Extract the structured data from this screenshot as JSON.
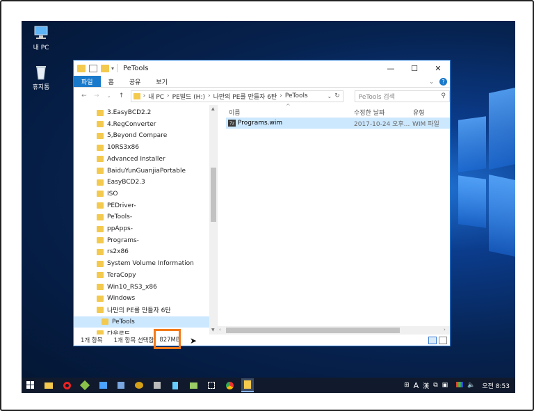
{
  "desktop": {
    "icons": [
      {
        "label": "내 PC",
        "icon": "computer-icon"
      },
      {
        "label": "휴지통",
        "icon": "recycle-bin-icon"
      }
    ]
  },
  "window": {
    "title": "PeTools",
    "controls": {
      "minimize": "—",
      "maximize": "☐",
      "close": "✕"
    },
    "ribbon_tabs": [
      "파일",
      "홈",
      "공유",
      "보기"
    ],
    "address": [
      "내 PC",
      "PE빌드 (H:)",
      "나만의 PE를 만들자 6탄",
      "PeTools"
    ],
    "search_placeholder": "PeTools 검색",
    "nav_items": [
      "3.EasyBCD2.2",
      "4.RegConverter",
      "5,Beyond Compare",
      "10RS3x86",
      "Advanced Installer",
      "BaiduYunGuanjiaPortable",
      "EasyBCD2.3",
      "ISO",
      "PEDriver-",
      "PeTools-",
      "ppApps-",
      "Programs-",
      "rs2x86",
      "System Volume Information",
      "TeraCopy",
      "Win10_RS3_x86",
      "Windows",
      "나만의 PE를 만들자 6탄",
      "PeTools",
      "다운로드"
    ],
    "selected_nav": "PeTools",
    "columns": {
      "name": "이름",
      "date": "수정한 날짜",
      "type": "유형"
    },
    "file": {
      "name": "Programs.wim",
      "date": "2017-10-24 오후...",
      "type": "WIM 파일"
    },
    "status": {
      "count": "1개 항목",
      "selected": "1개 항목 선택함",
      "size": "827MB"
    }
  },
  "taskbar": {
    "tray": {
      "ime_a": "A",
      "ime_han": "漢",
      "time": "오전 8:53"
    }
  }
}
